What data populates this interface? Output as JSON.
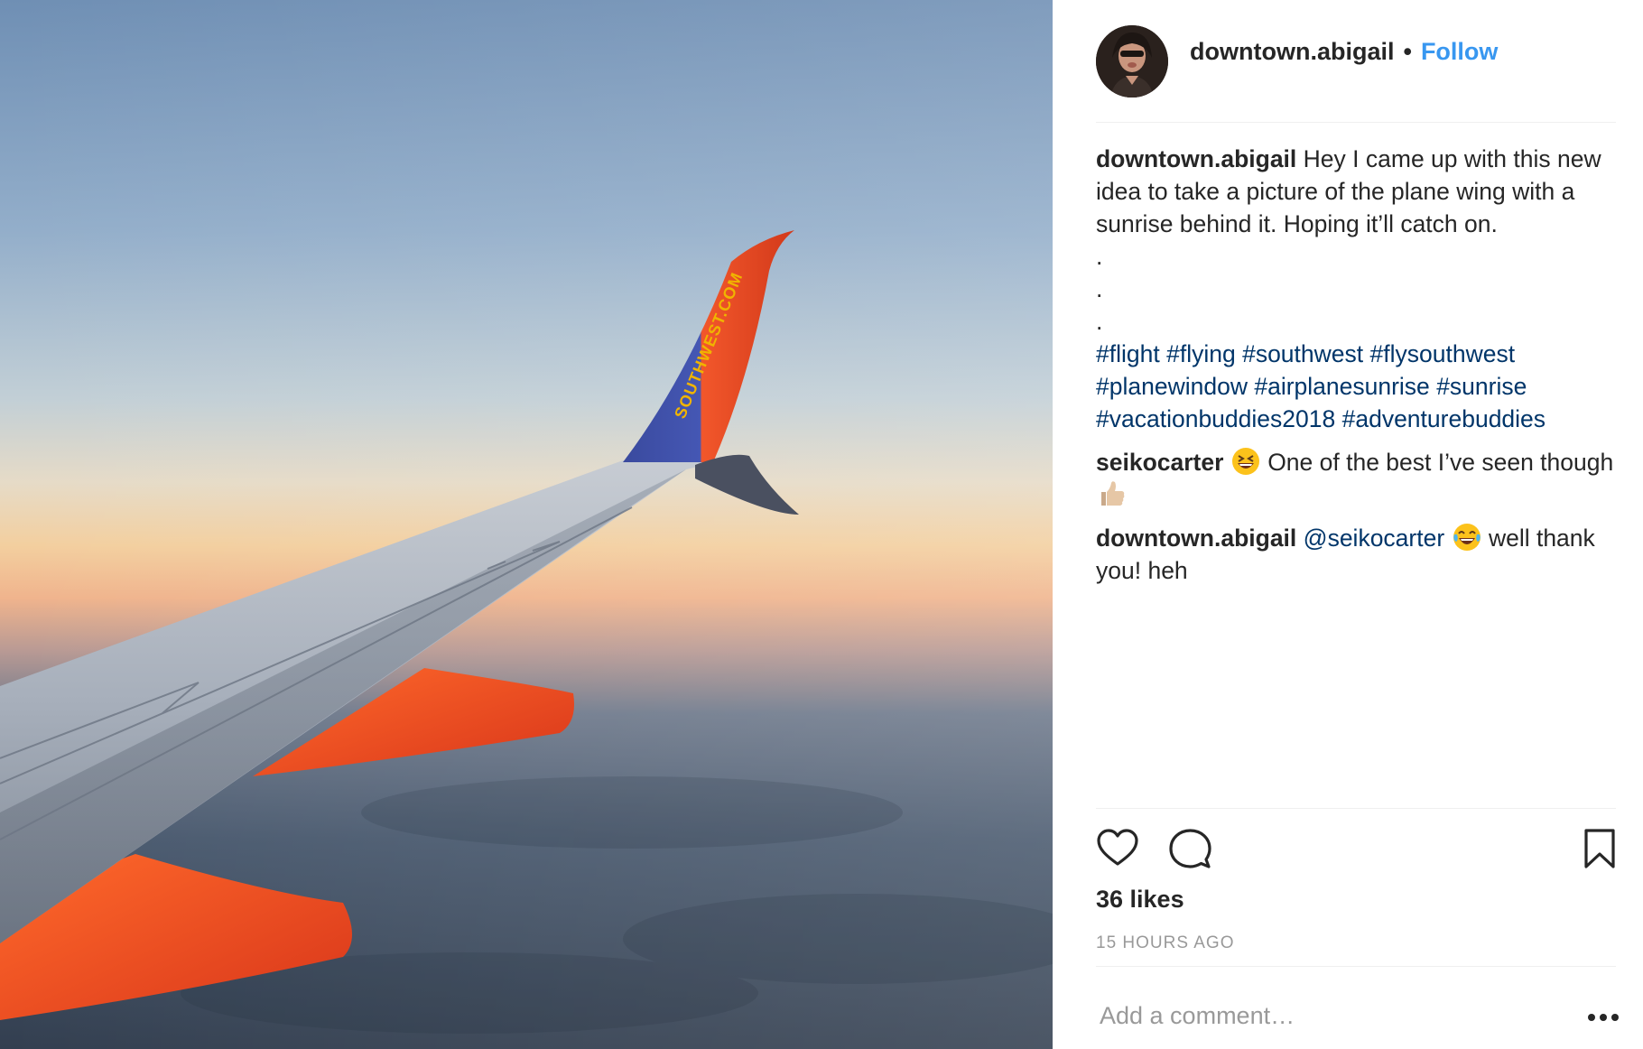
{
  "header": {
    "username": "downtown.abigail",
    "separator": "•",
    "follow_label": "Follow"
  },
  "caption": {
    "username": "downtown.abigail",
    "text": "Hey I came up with this new idea to take a picture of the plane wing with a sunrise behind it. Hoping it’ll catch on.",
    "dots": [
      ".",
      ".",
      "."
    ],
    "hashtags": [
      "#flight",
      "#flying",
      "#southwest",
      "#flysouthwest",
      "#planewindow",
      "#airplanesunrise",
      "#sunrise",
      "#vacationbuddies2018",
      "#adventurebuddies"
    ]
  },
  "comments": [
    {
      "username": "seikocarter",
      "emoji_before": "grinning-squinting-face",
      "text": "One of the best I’ve seen though",
      "emoji_after": "thumbs-up"
    },
    {
      "username": "downtown.abigail",
      "mention": "@seikocarter",
      "emoji": "face-with-tears-of-joy",
      "text": "well thank you! heh"
    }
  ],
  "photo": {
    "winglet_text": "SOUTHWEST.COM"
  },
  "likes": "36 likes",
  "timestamp": "15 HOURS AGO",
  "add_comment_placeholder": "Add a comment…",
  "icons": {
    "like": "heart-icon",
    "comment": "speech-bubble-icon",
    "save": "bookmark-icon",
    "more": "more-options-icon"
  },
  "colors": {
    "link": "#3897f0",
    "hashtag": "#003569",
    "muted": "#999999",
    "text": "#262626"
  }
}
